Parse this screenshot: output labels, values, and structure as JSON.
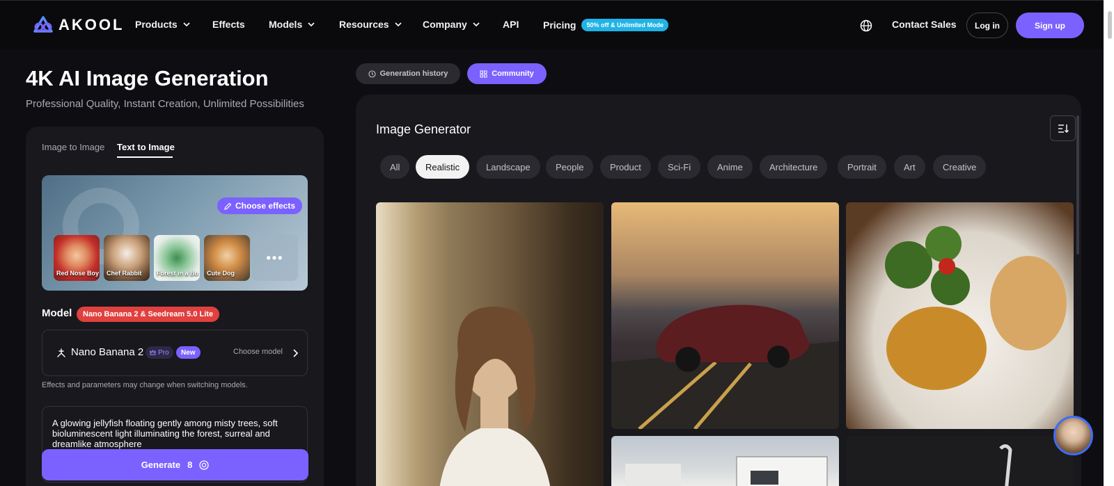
{
  "nav": {
    "logo_text": "AKOOL",
    "items": [
      {
        "label": "Products",
        "has_dropdown": true
      },
      {
        "label": "Effects",
        "has_dropdown": false
      },
      {
        "label": "Models",
        "has_dropdown": true
      },
      {
        "label": "Resources",
        "has_dropdown": true
      },
      {
        "label": "Company",
        "has_dropdown": true
      },
      {
        "label": "API",
        "has_dropdown": false
      },
      {
        "label": "Pricing",
        "has_dropdown": false
      }
    ],
    "promo_badge": "50% off & Unlimited Mode",
    "contact_sales": "Contact Sales",
    "login": "Log in",
    "signup": "Sign up",
    "icons": {
      "language": "globe-icon"
    }
  },
  "hero": {
    "title": "4K AI Image Generation",
    "subtitle": "Professional Quality, Instant Creation, Unlimited Possibilities"
  },
  "left_panel": {
    "tabs": [
      {
        "label": "Image to Image",
        "active": false
      },
      {
        "label": "Text to Image",
        "active": true
      }
    ],
    "effects": {
      "choose_label": "Choose effects",
      "presets": [
        {
          "label": "Red Nose Boy"
        },
        {
          "label": "Chef Rabbit"
        },
        {
          "label": "Forest in a Bo"
        },
        {
          "label": "Cute Dog"
        }
      ],
      "more_label": "•••"
    },
    "model": {
      "label": "Model",
      "badge": "Nano Banana 2 & Seedream 5.0 Lite",
      "selected_name": "Nano Banana 2",
      "pro_badge": "Pro",
      "new_badge": "New",
      "choose_label": "Choose model",
      "note": "Effects and parameters may change when switching models."
    },
    "prompt": "A glowing jellyfish floating gently among misty trees, soft bioluminescent light illuminating the forest, surreal and dreamlike atmosphere",
    "generate": {
      "label": "Generate",
      "cost": "8"
    }
  },
  "right_panel": {
    "history_button": "Generation history",
    "community_button": "Community",
    "title": "Image Generator",
    "categories": [
      {
        "label": "All",
        "active": false
      },
      {
        "label": "Realistic",
        "active": true
      },
      {
        "label": "Landscape",
        "active": false
      },
      {
        "label": "People",
        "active": false
      },
      {
        "label": "Product",
        "active": false
      },
      {
        "label": "Sci-Fi",
        "active": false
      },
      {
        "label": "Anime",
        "active": false
      },
      {
        "label": "Architecture",
        "active": false
      },
      {
        "label": "Portrait",
        "active": false
      },
      {
        "label": "Art",
        "active": false
      },
      {
        "label": "Creative",
        "active": false
      }
    ],
    "gallery": [
      {
        "subject": "woman by window"
      },
      {
        "subject": "red sports car on coastal road"
      },
      {
        "subject": "plate of food with broccoli and bread"
      },
      {
        "subject": "modern house"
      },
      {
        "subject": "dark product shot"
      }
    ]
  },
  "colors": {
    "accent": "#7b61ff",
    "background": "#0e0e12",
    "card": "#18181d",
    "model_badge": "#e0403e",
    "promo": "#20b3e6"
  }
}
